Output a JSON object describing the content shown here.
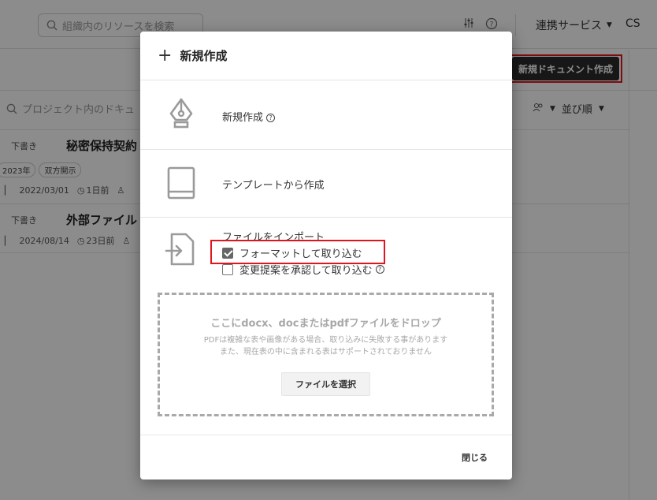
{
  "topbar": {
    "search_placeholder": "組織内のリソースを検索",
    "service_menu_label": "連携サービス",
    "user_label": "CS"
  },
  "toolbar": {
    "new_document_label": "新規ドキュメント作成"
  },
  "project": {
    "search_placeholder": "プロジェクト内のドキュ",
    "sort_label": "並び順"
  },
  "documents": [
    {
      "status": "下書き",
      "title": "秘密保持契約",
      "chips": [
        "2023年",
        "双方開示"
      ],
      "date": "2022/03/01",
      "updated": "1日前"
    },
    {
      "status": "下書き",
      "title": "外部ファイル",
      "chips": [],
      "date": "2024/08/14",
      "updated": "23日前"
    }
  ],
  "modal": {
    "title": "新規作成",
    "options": {
      "new": "新規作成",
      "template": "テンプレートから作成",
      "import": "ファイルをインポート"
    },
    "checkboxes": {
      "format_import": {
        "label": "フォーマットして取り込む",
        "checked": true
      },
      "approve_changes": {
        "label": "変更提案を承認して取り込む",
        "checked": false
      }
    },
    "dropzone": {
      "title": "ここにdocx、docまたはpdfファイルをドロップ",
      "note_line1": "PDFは複雑な表や画像がある場合、取り込みに失敗する事があります",
      "note_line2": "また、現在表の中に含まれる表はサポートされておりません",
      "select_button": "ファイルを選択"
    },
    "close_label": "閉じる"
  },
  "colors": {
    "highlight_red": "#e0161e",
    "primary_dark": "#2b2b2b",
    "overlay": "rgba(0,0,0,0.45)"
  }
}
